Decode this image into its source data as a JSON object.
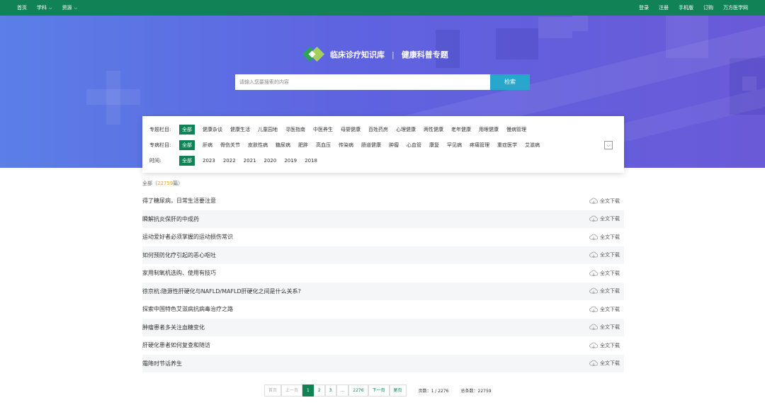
{
  "topbar": {
    "left": [
      {
        "label": "首页",
        "dropdown": false
      },
      {
        "label": "学科",
        "dropdown": true
      },
      {
        "label": "资源",
        "dropdown": true
      }
    ],
    "right": [
      "登录",
      "注册",
      "手机版",
      "订购",
      "万方医学网"
    ]
  },
  "brand": {
    "name": "临床诊疗知识库",
    "separator": "|",
    "subtitle": "健康科普专题"
  },
  "search": {
    "placeholder": "请输入您要搜索的内容",
    "button": "检索"
  },
  "filters": [
    {
      "label": "专题栏目:",
      "options": [
        "全部",
        "健康杂谈",
        "健康生活",
        "儿童园地",
        "寻医指南",
        "中医养生",
        "母婴健康",
        "百姓药房",
        "心理健康",
        "两性健康",
        "老年健康",
        "用眼健康",
        "慢病管理"
      ],
      "active": 0,
      "more": false
    },
    {
      "label": "专病栏目:",
      "options": [
        "全部",
        "肝病",
        "骨伤关节",
        "皮肤性病",
        "糖尿病",
        "肥胖",
        "高血压",
        "传染病",
        "肠道健康",
        "肿瘤",
        "心血管",
        "康复",
        "罕见病",
        "疼痛管理",
        "重症医学",
        "艾滋病"
      ],
      "active": 0,
      "more": true
    },
    {
      "label": "时间:",
      "options": [
        "全部",
        "2023",
        "2022",
        "2021",
        "2020",
        "2019",
        "2018"
      ],
      "active": 0,
      "more": false
    }
  ],
  "count": {
    "label": "全部",
    "open": "（",
    "number": "22759",
    "unit": "篇）"
  },
  "articles": [
    {
      "title": "得了糖尿病，日常生活要注意",
      "action": "全文下载"
    },
    {
      "title": "瞬解抗炎保肝的中成药",
      "action": "全文下载"
    },
    {
      "title": "运动爱好者必须掌握的运动损伤常识",
      "action": "全文下载"
    },
    {
      "title": "如何预防化疗引起的恶心呕吐",
      "action": "全文下载"
    },
    {
      "title": "家用制氧机选购、使用有技巧",
      "action": "全文下载"
    },
    {
      "title": "徐京杭:隐源性肝硬化与NAFLD/MAFLD肝硬化之间是什么关系?",
      "action": "全文下载"
    },
    {
      "title": "探索中国特色艾滋病抗病毒治疗之路",
      "action": "全文下载"
    },
    {
      "title": "肿瘤患者多关注血糖变化",
      "action": "全文下载"
    },
    {
      "title": "肝硬化患者如何复查和随访",
      "action": "全文下载"
    },
    {
      "title": "霜降时节话养生",
      "action": "全文下载"
    }
  ],
  "pager": {
    "first": "首页",
    "prev": "上一页",
    "pages": [
      "1",
      "2",
      "3",
      "...",
      "2276"
    ],
    "current": "1",
    "next": "下一页",
    "last": "尾页",
    "page_info": "页数：1 / 2276",
    "total_info": "总条数：22759"
  },
  "colors": {
    "topbar": "#118256",
    "accent": "#118256",
    "search_button": "#27a7c9",
    "count_number": "#e4a23a"
  }
}
